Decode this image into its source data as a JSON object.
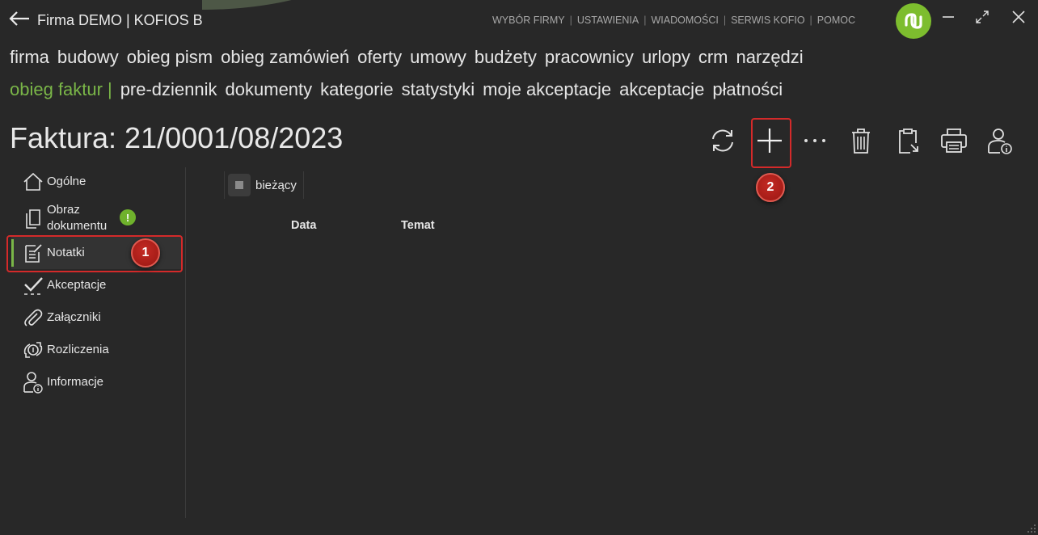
{
  "titlebar": {
    "title": "Firma DEMO | KOFIOS B",
    "links": [
      "WYBÓR FIRMY",
      "USTAWIENIA",
      "WIADOMOŚCI",
      "SERWIS KOFIO",
      "POMOC"
    ],
    "separator": "|"
  },
  "nav": {
    "row1": [
      "firma",
      "budowy",
      "obieg pism",
      "obieg zamówień",
      "oferty",
      "umowy",
      "budżety",
      "pracownicy",
      "urlopy",
      "crm",
      "narzędzi"
    ],
    "row2_active": "obieg faktur",
    "row2_bar": "|",
    "row2": [
      "pre-dziennik",
      "dokumenty",
      "kategorie",
      "statystyki",
      "moje akceptacje",
      "akceptacje",
      "płatności"
    ]
  },
  "page": {
    "title": "Faktura: 21/0001/08/2023"
  },
  "toolbar": {
    "icons": [
      "refresh-icon",
      "add-icon",
      "more-icon",
      "delete-icon",
      "clipboard-icon",
      "print-icon",
      "user-info-icon"
    ]
  },
  "sidebar": {
    "items": [
      {
        "label": "Ogólne",
        "icon": "home-icon"
      },
      {
        "label": "Obraz dokumentu",
        "icon": "document-copy-icon"
      },
      {
        "label": "Notatki",
        "icon": "note-edit-icon"
      },
      {
        "label": "Akceptacje",
        "icon": "checkmark-icon"
      },
      {
        "label": "Załączniki",
        "icon": "paperclip-icon"
      },
      {
        "label": "Rozliczenia",
        "icon": "money-exchange-icon"
      },
      {
        "label": "Informacje",
        "icon": "user-info-icon"
      }
    ],
    "warning_mark": "!"
  },
  "filter": {
    "label": "bieżący"
  },
  "table": {
    "columns": [
      "Data",
      "Temat"
    ]
  },
  "annotations": {
    "badge1": "1",
    "badge2": "2"
  },
  "colors": {
    "accent": "#7ab648",
    "background": "#282828",
    "highlight": "#d42a2a",
    "logo": "#7dbd2e"
  }
}
